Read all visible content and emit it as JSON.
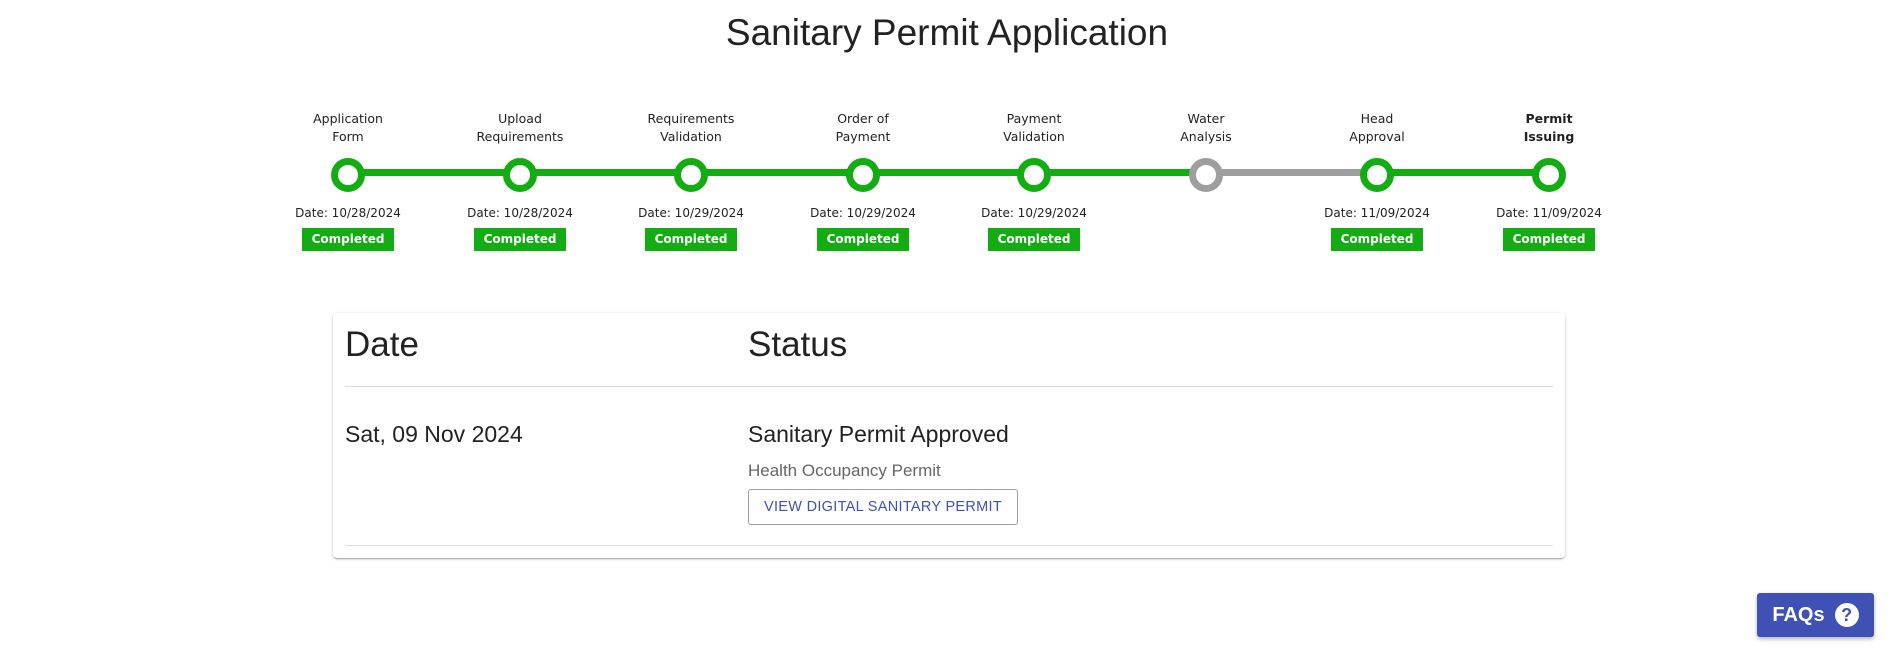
{
  "page_title": "Sanitary Permit Application",
  "colors": {
    "complete": "#13ad13",
    "pending": "#9e9e9e",
    "primary": "#3f51b5"
  },
  "steps": [
    {
      "label": "Application\nForm",
      "date": "Date: 10/28/2024",
      "status": "Completed",
      "state": "complete"
    },
    {
      "label": "Upload\nRequirements",
      "date": "Date: 10/28/2024",
      "status": "Completed",
      "state": "complete"
    },
    {
      "label": "Requirements\nValidation",
      "date": "Date: 10/29/2024",
      "status": "Completed",
      "state": "complete"
    },
    {
      "label": "Order of\nPayment",
      "date": "Date: 10/29/2024",
      "status": "Completed",
      "state": "complete"
    },
    {
      "label": "Payment\nValidation",
      "date": "Date: 10/29/2024",
      "status": "Completed",
      "state": "complete"
    },
    {
      "label": "Water\nAnalysis",
      "date": "",
      "status": "",
      "state": "pending"
    },
    {
      "label": "Head\nApproval",
      "date": "Date: 11/09/2024",
      "status": "Completed",
      "state": "complete"
    },
    {
      "label": "Permit\nIssuing",
      "date": "Date: 11/09/2024",
      "status": "Completed",
      "state": "complete",
      "active": true
    }
  ],
  "table": {
    "headers": {
      "date": "Date",
      "status": "Status"
    },
    "rows": [
      {
        "date": "Sat, 09 Nov 2024",
        "status": "Sanitary Permit Approved",
        "sub": "Health Occupancy Permit",
        "action_label": "VIEW DIGITAL SANITARY PERMIT"
      }
    ]
  },
  "faq": {
    "label": "FAQs",
    "icon": "help-icon"
  }
}
